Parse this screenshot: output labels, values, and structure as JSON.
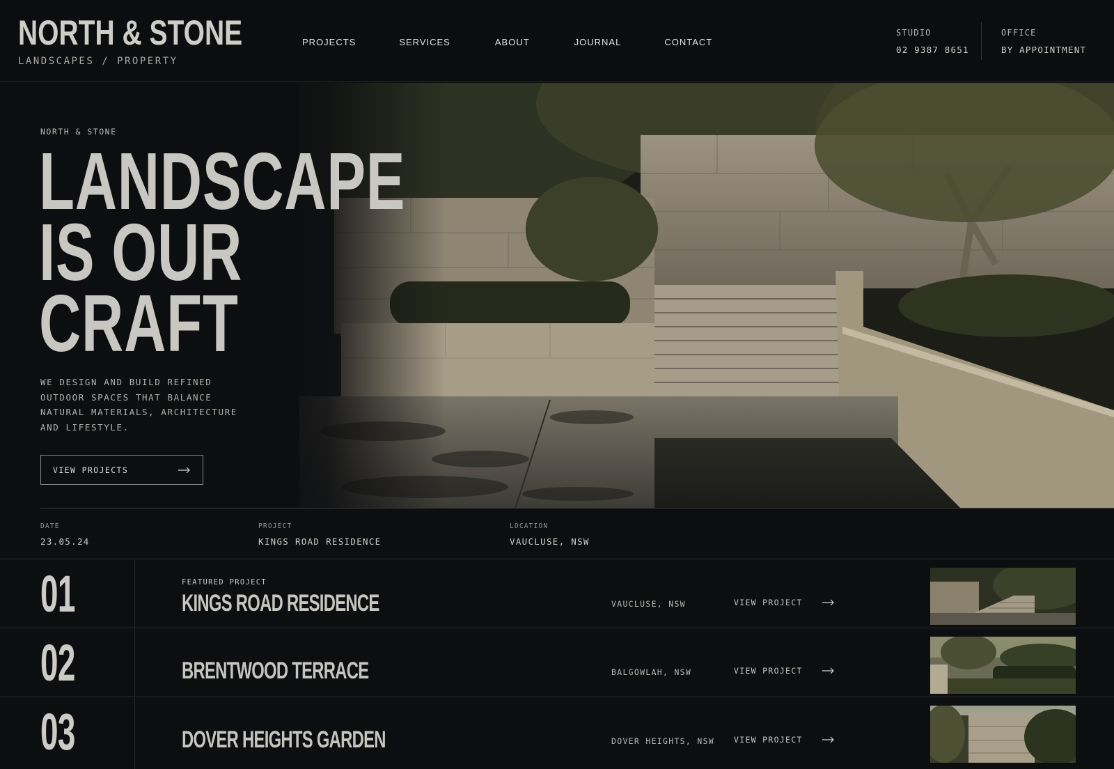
{
  "header": {
    "brand_title": "NORTH & STONE",
    "brand_sub": "LANDSCAPES / PROPERTY",
    "nav": [
      "PROJECTS",
      "SERVICES",
      "ABOUT",
      "JOURNAL",
      "CONTACT"
    ],
    "studio_label": "STUDIO",
    "studio_value": "02 9387 8651",
    "office_label": "OFFICE",
    "office_value": "BY APPOINTMENT"
  },
  "hero": {
    "eyebrow": "NORTH & STONE",
    "headline": [
      "LANDSCAPE",
      "IS OUR",
      "CRAFT"
    ],
    "copy": "WE DESIGN AND BUILD REFINED OUTDOOR SPACES THAT BALANCE NATURAL MATERIALS, ARCHITECTURE AND LIFESTYLE.",
    "cta_label": "VIEW PROJECTS"
  },
  "meta": {
    "date_label": "DATE",
    "date_value": "23.05.24",
    "project_label": "PROJECT",
    "project_value": "KINGS ROAD RESIDENCE",
    "location_label": "LOCATION",
    "location_value": "VAUCLUSE, NSW"
  },
  "projects": [
    {
      "num": "01",
      "eyebrow": "FEATURED PROJECT",
      "title": "KINGS ROAD RESIDENCE",
      "location": "VAUCLUSE, NSW",
      "link": "VIEW PROJECT"
    },
    {
      "num": "02",
      "eyebrow": "",
      "title": "BRENTWOOD TERRACE",
      "location": "BALGOWLAH, NSW",
      "link": "VIEW PROJECT"
    },
    {
      "num": "03",
      "eyebrow": "",
      "title": "DOVER HEIGHTS GARDEN",
      "location": "DOVER HEIGHTS, NSW",
      "link": "VIEW PROJECT"
    }
  ],
  "colors": {
    "background": "#0d0e10",
    "text": "#d8d6d1",
    "rule": "#2a2b2d",
    "stone": "#b7ab94",
    "foliage": "#2f3323"
  }
}
